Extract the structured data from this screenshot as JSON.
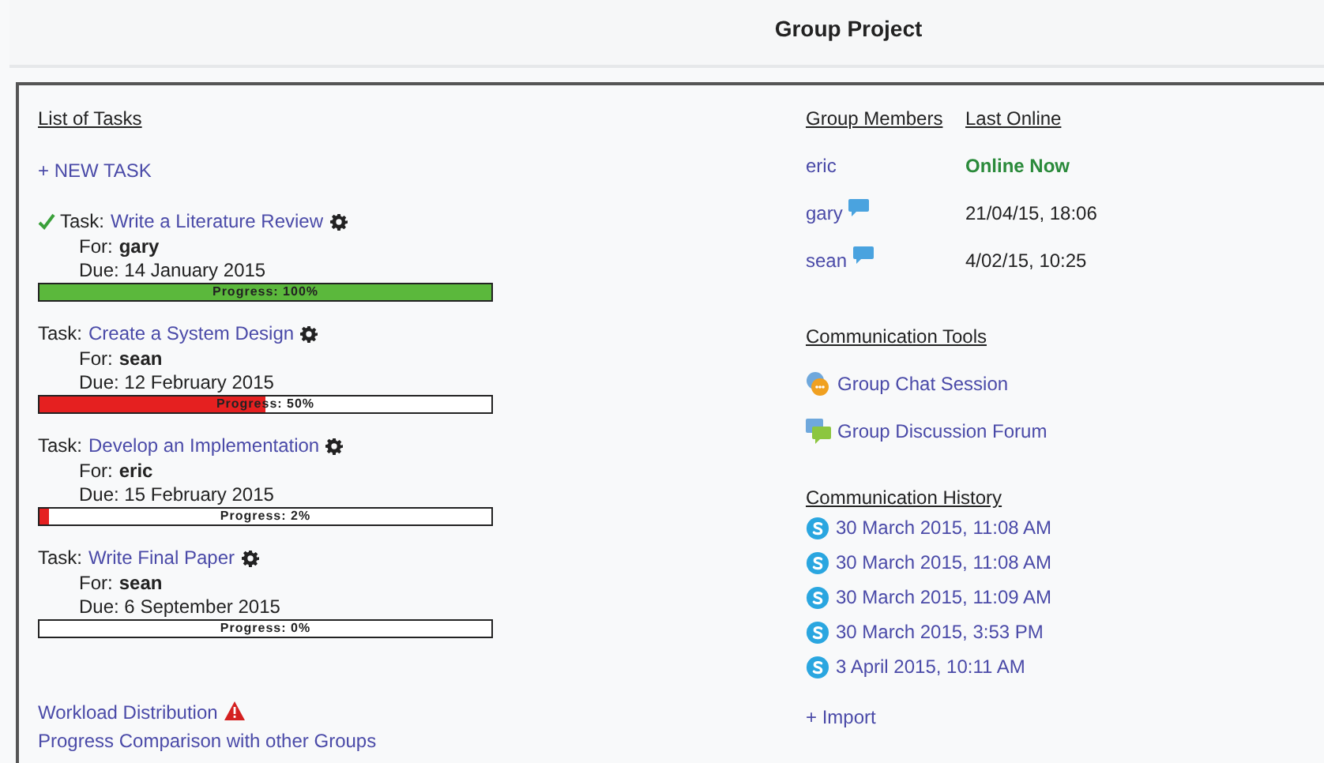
{
  "page": {
    "title": "Group Project"
  },
  "tasks_section": {
    "heading": "List of Tasks",
    "new_task": "+ NEW TASK",
    "tasks": [
      {
        "completed": true,
        "label": "Task:",
        "title": "Write a Literature Review",
        "for_label": "For:",
        "assignee": "gary",
        "due": "Due: 14 January 2015",
        "level": 1,
        "progress": "Progress: 100%"
      },
      {
        "completed": false,
        "label": "Task:",
        "title": "Create a System Design",
        "for_label": "For:",
        "assignee": "sean",
        "due": "Due: 12 February 2015",
        "level": 0.5,
        "progress": "Progress: 50%"
      },
      {
        "completed": false,
        "label": "Task:",
        "title": "Develop an Implementation",
        "for_label": "For:",
        "assignee": "eric",
        "due": "Due: 15 February 2015",
        "level": 0.02,
        "progress": "Progress: 2%"
      },
      {
        "completed": false,
        "label": "Task:",
        "title": "Write Final Paper",
        "for_label": "For:",
        "assignee": "sean",
        "due": "Due: 6 September 2015",
        "level": 0,
        "progress": "Progress: 0%"
      }
    ],
    "links": [
      {
        "text": "Workload Distribution",
        "warning": true
      },
      {
        "text": "Progress Comparison with other Groups",
        "warning": false
      }
    ]
  },
  "members": {
    "columns": [
      "Group Members",
      "Last Online"
    ],
    "rows": [
      {
        "name": "eric",
        "chat": false,
        "last_online": "Online Now",
        "online": true
      },
      {
        "name": "gary",
        "chat": true,
        "last_online": "21/04/15, 18:06",
        "online": false
      },
      {
        "name": "sean",
        "chat": true,
        "last_online": "4/02/15, 10:25",
        "online": false
      }
    ]
  },
  "tools": {
    "heading": "Communication Tools",
    "items": [
      {
        "kind": "chat",
        "text": "Group Chat Session"
      },
      {
        "kind": "forum",
        "text": "Group Discussion Forum"
      }
    ]
  },
  "history": {
    "heading": "Communication History",
    "items": [
      "30 March 2015, 11:08 AM",
      "30 March 2015, 11:08 AM",
      "30 March 2015, 11:09 AM",
      "30 March 2015, 3:53 PM",
      "3 April 2015, 10:11 AM"
    ],
    "import": "+ Import"
  }
}
